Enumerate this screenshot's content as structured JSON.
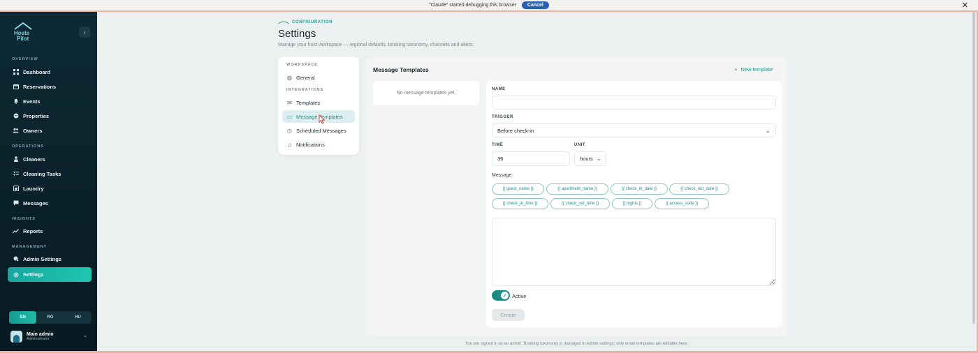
{
  "debug_banner": {
    "text": "\"Claude\" started debugging this browser",
    "cancel_label": "Cancel",
    "close_glyph": "✕"
  },
  "sidebar": {
    "collapse_glyph": "‹",
    "sections": {
      "overview": "OVERVIEW",
      "operations": "OPERATIONS",
      "insights": "INSIGHTS",
      "management": "MANAGEMENT"
    },
    "items": [
      {
        "label": "Dashboard",
        "icon": "grid-icon"
      },
      {
        "label": "Reservations",
        "icon": "calendar-icon"
      },
      {
        "label": "Events",
        "icon": "bell-icon"
      },
      {
        "label": "Properties",
        "icon": "globe-icon"
      },
      {
        "label": "Owners",
        "icon": "users-icon"
      },
      {
        "label": "Cleaners",
        "icon": "person-icon"
      },
      {
        "label": "Cleaning Tasks",
        "icon": "checklist-icon"
      },
      {
        "label": "Laundry",
        "icon": "laundry-icon"
      },
      {
        "label": "Messages",
        "icon": "chat-icon"
      },
      {
        "label": "Reports",
        "icon": "trend-icon"
      },
      {
        "label": "Admin Settings",
        "icon": "admin-icon"
      },
      {
        "label": "Settings",
        "icon": "gear-icon"
      }
    ],
    "languages": [
      "EN",
      "RO",
      "HU"
    ],
    "user": {
      "name": "Main admin",
      "role": "Administrator"
    }
  },
  "header": {
    "crumb": "CONFIGURATION",
    "title": "Settings",
    "subtitle": "Manage your host workspace — regional defaults, booking taxonomy, channels and alerts."
  },
  "settings_nav": {
    "workspace_label": "WORKSPACE",
    "integrations_label": "INTEGRATIONS",
    "items": [
      "General",
      "Templates",
      "Message Templates",
      "Scheduled Messages",
      "Notifications"
    ]
  },
  "panel": {
    "title": "Message Templates",
    "new_template_label": "New template",
    "empty_text": "No message templates yet."
  },
  "form": {
    "name_label": "NAME",
    "name_value": "",
    "trigger_label": "TRIGGER",
    "trigger_value": "Before check-in",
    "time_label": "TIME",
    "time_value": "36",
    "unit_label": "UNIT",
    "unit_value": "hours",
    "message_label": "Message",
    "message_value": "",
    "variables": [
      "{{ guest_name }}",
      "{{ apartment_name }}",
      "{{ check_in_date }}",
      "{{ check_out_date }}",
      "{{ check_in_time }}",
      "{{ check_out_time }}",
      "{{ nights }}",
      "{{ access_code }}"
    ],
    "active_label": "Active",
    "active": true,
    "create_label": "Create"
  },
  "footer_note": "You are signed in as an admin. Booking taxonomy is managed in Admin settings; only email templates are editable here.",
  "colors": {
    "accent": "#1b8c83",
    "sidebar_bg": "#0d2a35",
    "active_nav": "#1ec7b0"
  }
}
